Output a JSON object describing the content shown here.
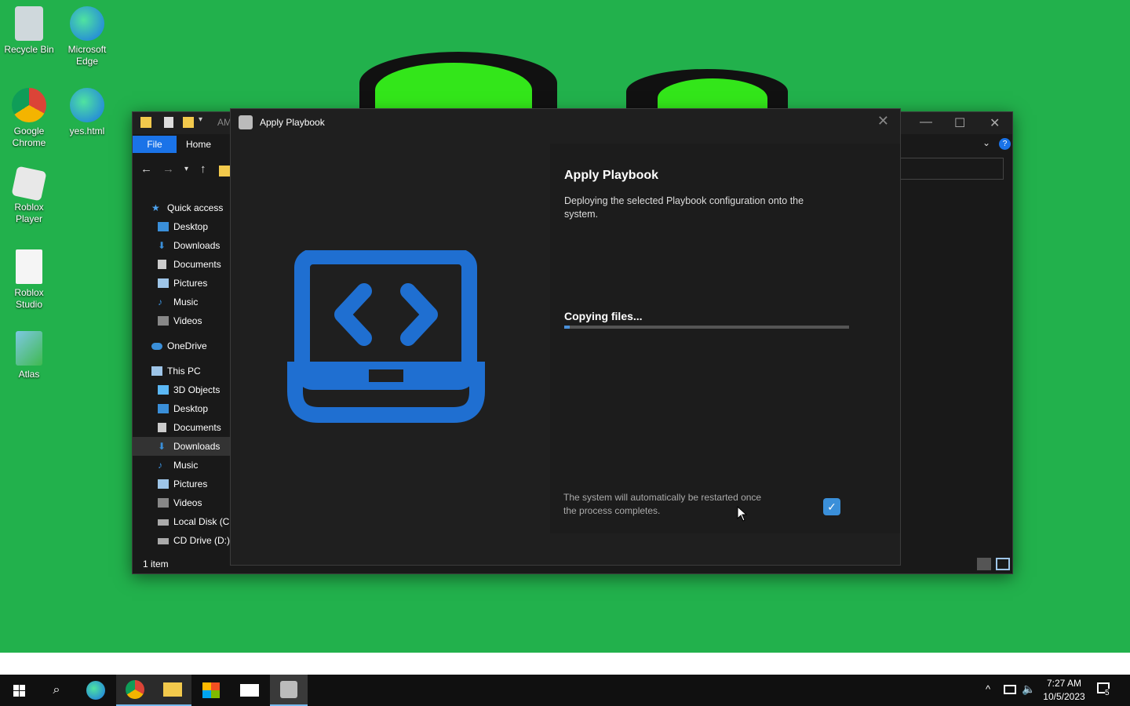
{
  "desktop": {
    "icons": [
      {
        "label": "Recycle Bin"
      },
      {
        "label": "Microsoft Edge"
      },
      {
        "label": "Google Chrome"
      },
      {
        "label": "yes.html"
      },
      {
        "label": "Roblox Player"
      },
      {
        "label": "Roblox Studio"
      },
      {
        "label": "Atlas"
      }
    ]
  },
  "explorer": {
    "title_fragment": "AM",
    "ribbon": {
      "file": "File",
      "home": "Home"
    },
    "sidebar": {
      "quick_access": "Quick access",
      "quick_items": [
        "Desktop",
        "Downloads",
        "Documents",
        "Pictures",
        "Music",
        "Videos"
      ],
      "onedrive": "OneDrive",
      "this_pc": "This PC",
      "pc_items": [
        "3D Objects",
        "Desktop",
        "Documents",
        "Downloads",
        "Music",
        "Pictures",
        "Videos",
        "Local Disk (C:",
        "CD Drive (D:)"
      ]
    },
    "status": "1 item"
  },
  "dialog": {
    "window_title": "Apply Playbook",
    "heading": "Apply Playbook",
    "description": "Deploying the selected Playbook configuration onto the system.",
    "progress_label": "Copying files...",
    "progress_fraction": 0.02,
    "restart_note": "The system will automatically be restarted once the process completes.",
    "restart_checked": true
  },
  "taskbar": {
    "time": "7:27 AM",
    "date": "10/5/2023",
    "notification_count": "5"
  },
  "colors": {
    "wallpaper": "#22b14c",
    "accent": "#1a73e8",
    "logo_blue": "#1f6fd1"
  }
}
